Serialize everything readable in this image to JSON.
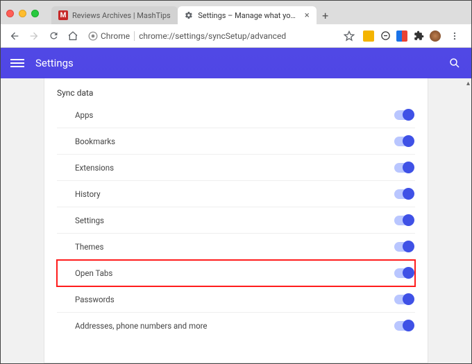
{
  "window": {
    "tabs": [
      {
        "title": "Reviews Archives | MashTips",
        "active": false,
        "favicon_letter": "M",
        "favicon_bg": "#c62828"
      },
      {
        "title": "Settings – Manage what you s",
        "active": true
      }
    ]
  },
  "toolbar": {
    "chrome_label": "Chrome",
    "url": "chrome://settings/syncSetup/advanced"
  },
  "settings": {
    "app_title": "Settings",
    "section_title": "Sync data",
    "items": [
      {
        "label": "Apps",
        "on": true,
        "highlight": false
      },
      {
        "label": "Bookmarks",
        "on": true,
        "highlight": false
      },
      {
        "label": "Extensions",
        "on": true,
        "highlight": false
      },
      {
        "label": "History",
        "on": true,
        "highlight": false
      },
      {
        "label": "Settings",
        "on": true,
        "highlight": false
      },
      {
        "label": "Themes",
        "on": true,
        "highlight": false
      },
      {
        "label": "Open Tabs",
        "on": true,
        "highlight": true
      },
      {
        "label": "Passwords",
        "on": true,
        "highlight": false
      },
      {
        "label": "Addresses, phone numbers and more",
        "on": true,
        "highlight": false
      }
    ]
  },
  "colors": {
    "accent": "#4f46e5",
    "highlight_border": "#ff1c1c"
  }
}
